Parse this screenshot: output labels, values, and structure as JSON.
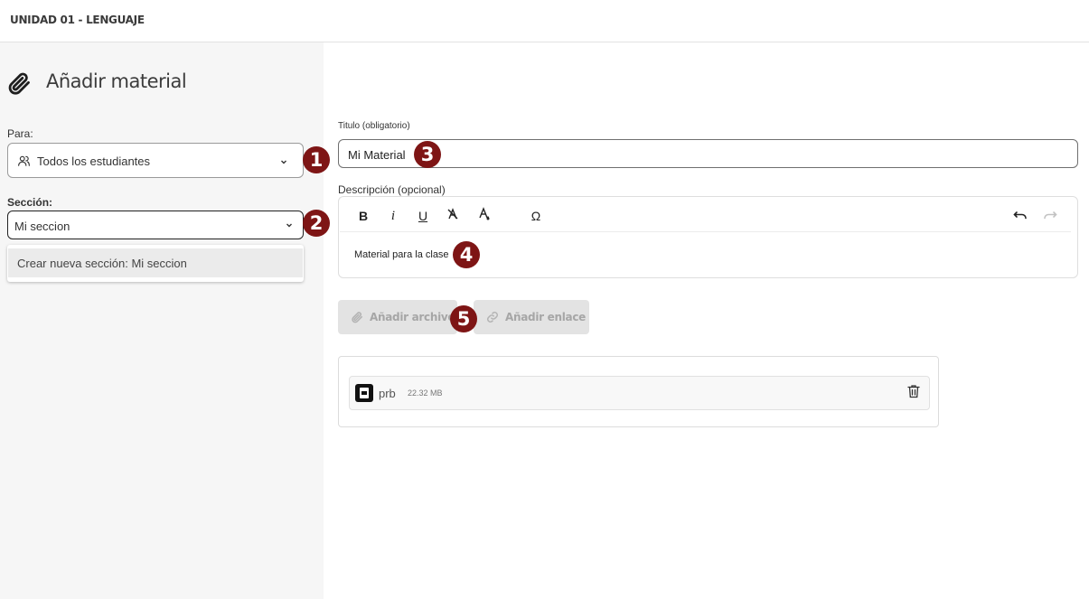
{
  "header": {
    "course_title": "UNIDAD 01 - LENGUAJE"
  },
  "sidebar": {
    "title": "Añadir material",
    "title_icon": "paperclip-icon",
    "para_label": "Para:",
    "para_value": "Todos los estudiantes",
    "para_icon": "users-icon",
    "seccion_label": "Sección:",
    "seccion_value": "Mi seccion",
    "dropdown_option": "Crear nueva sección: Mi seccion"
  },
  "badges": [
    "1",
    "2",
    "3",
    "4",
    "5"
  ],
  "form": {
    "title_label": "Titulo (obligatorio)",
    "title_value": "Mi Material",
    "description_label": "Descripción (opcional)",
    "description_value": "Material para la clase",
    "toolbar": {
      "bold": "B",
      "italic": "i",
      "underline": "U",
      "special_char": "Ω"
    },
    "add_file_label": "Añadir archivo",
    "add_link_label": "Añadir enlace"
  },
  "files": [
    {
      "name": "prb",
      "size": "22.32 MB",
      "icon": "pdf-file-icon"
    }
  ],
  "colors": {
    "badge": "#7e1515",
    "sidebar_bg": "#f6f6f6",
    "disabled_btn": "#e3e3e3"
  }
}
